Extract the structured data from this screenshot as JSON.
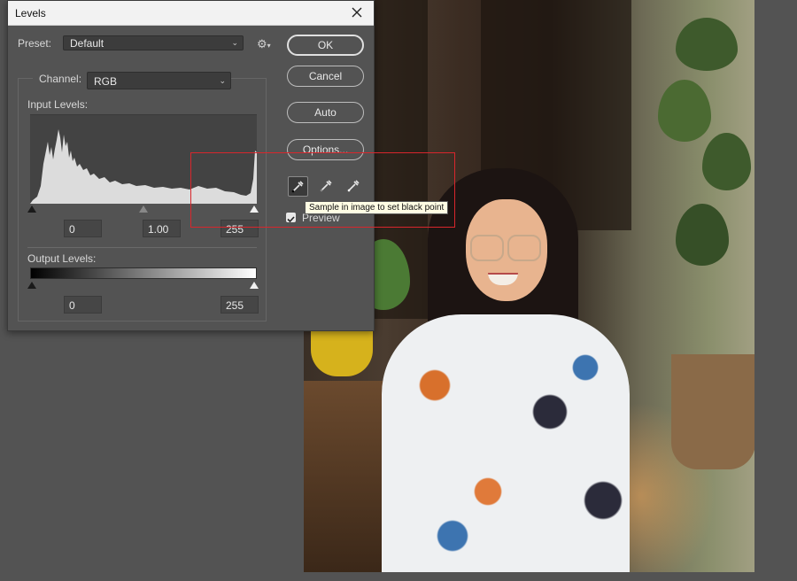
{
  "dialog": {
    "title": "Levels",
    "preset_label": "Preset:",
    "preset_value": "Default",
    "channel_label": "Channel:",
    "channel_value": "RGB",
    "input_levels_label": "Input Levels:",
    "input_black": "0",
    "input_gamma": "1.00",
    "input_white": "255",
    "output_levels_label": "Output Levels:",
    "output_black": "0",
    "output_white": "255",
    "buttons": {
      "ok": "OK",
      "cancel": "Cancel",
      "auto": "Auto",
      "options": "Options..."
    },
    "preview_label": "Preview",
    "preview_checked": true,
    "tooltip": "Sample in image to set black point"
  },
  "colors": {
    "dialog_bg": "#535353",
    "highlight": "#d8262c",
    "tooltip_bg": "#fffde4"
  },
  "icons": [
    "close-icon",
    "gear-icon",
    "chevron-down-icon",
    "black-point-eyedropper-icon",
    "gray-point-eyedropper-icon",
    "white-point-eyedropper-icon",
    "checkmark-icon"
  ]
}
